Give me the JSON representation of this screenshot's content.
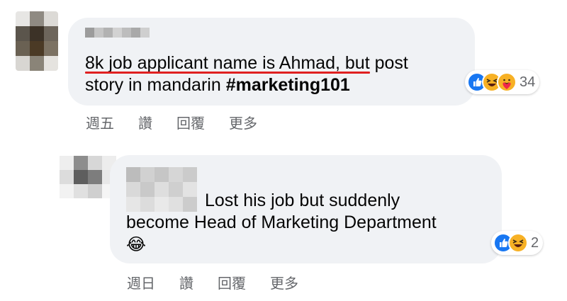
{
  "comments": [
    {
      "text_line1": "8k job applicant name is Ahmad",
      "text_line1_rest": ", but post",
      "text_line2": "story in mandarin ",
      "hashtag": "#marketing101",
      "reaction_count": "34",
      "reactions": [
        "like-icon",
        "haha-icon",
        "care-icon"
      ],
      "actions": [
        "週五",
        "讚",
        "回覆",
        "更多"
      ]
    },
    {
      "text_line1": "Lost his job but suddenly",
      "text_line2": "become Head of Marketing Department",
      "emoji": "😂",
      "reaction_count": "2",
      "reactions": [
        "like-icon",
        "haha-icon"
      ],
      "actions": [
        "週日",
        "讚",
        "回覆",
        "更多"
      ]
    }
  ],
  "colors": {
    "bubble": "#f0f2f5",
    "underline": "#e02020",
    "like": "#1877f2",
    "haha": "#f7b125",
    "muted": "#65676b"
  }
}
